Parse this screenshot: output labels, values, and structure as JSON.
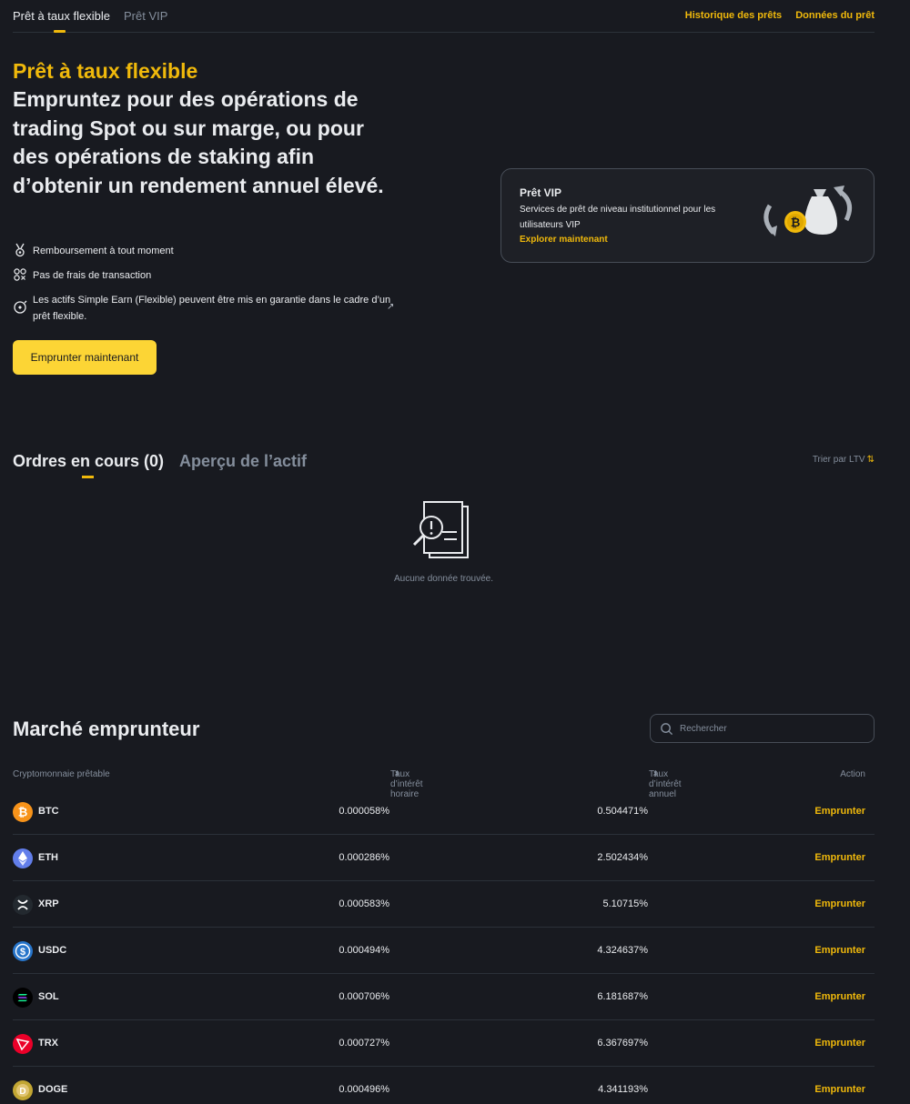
{
  "topnav": {
    "tab_flexible": "Prêt à taux flexible",
    "tab_vip": "Prêt VIP",
    "link_history": "Historique des prêts",
    "link_data": "Données du prêt"
  },
  "hero": {
    "title": "Prêt à taux flexible",
    "subtitle": "Empruntez pour des opérations de trading Spot ou sur marge, ou pour des opérations de staking afin d’obtenir un rendement annuel élevé.",
    "features": [
      {
        "icon": "medal-icon",
        "text": "Remboursement à tout moment"
      },
      {
        "icon": "coins-icon",
        "text": "Pas de frais de transaction"
      },
      {
        "icon": "collateral-icon",
        "text": "Les actifs Simple Earn (Flexible) peuvent être mis en garantie dans le cadre d’un prêt flexible."
      }
    ],
    "external_glyph": "↗",
    "borrow_button": "Emprunter maintenant"
  },
  "vip_card": {
    "title": "Prêt VIP",
    "description": "Services de prêt de niveau institutionnel pour les utilisateurs VIP",
    "link": "Explorer maintenant"
  },
  "orders": {
    "tab_open": "Ordres en cours (0)",
    "tab_assets": "Aperçu de l’actif",
    "sort_label": "Trier par LTV",
    "sort_icon": "⇅",
    "empty_text": "Aucune donnée trouvée."
  },
  "market": {
    "title": "Marché emprunteur",
    "search_placeholder": "Rechercher",
    "columns": {
      "coin": "Cryptomonnaie prêtable",
      "hourly": "Taux d’intérêt horaire",
      "annual": "Taux d’intérêt annuel",
      "action": "Action"
    },
    "sort_glyph": "⬍",
    "rows": [
      {
        "symbol": "BTC",
        "hourly": "0.000058%",
        "annual": "0.504471%",
        "action": "Emprunter",
        "icon": "btc-icon",
        "color": "#f7931a"
      },
      {
        "symbol": "ETH",
        "hourly": "0.000286%",
        "annual": "2.502434%",
        "action": "Emprunter",
        "icon": "eth-icon",
        "color": "#627eea"
      },
      {
        "symbol": "XRP",
        "hourly": "0.000583%",
        "annual": "5.10715%",
        "action": "Emprunter",
        "icon": "xrp-icon",
        "color": "#23292f"
      },
      {
        "symbol": "USDC",
        "hourly": "0.000494%",
        "annual": "4.324637%",
        "action": "Emprunter",
        "icon": "usdc-icon",
        "color": "#2775ca"
      },
      {
        "symbol": "SOL",
        "hourly": "0.000706%",
        "annual": "6.181687%",
        "action": "Emprunter",
        "icon": "sol-icon",
        "color": "#000000"
      },
      {
        "symbol": "TRX",
        "hourly": "0.000727%",
        "annual": "6.367697%",
        "action": "Emprunter",
        "icon": "trx-icon",
        "color": "#eb0029"
      },
      {
        "symbol": "DOGE",
        "hourly": "0.000496%",
        "annual": "4.341193%",
        "action": "Emprunter",
        "icon": "doge-icon",
        "color": "#c2a633"
      }
    ]
  },
  "colors": {
    "accent": "#f0b90b",
    "button": "#fcd535",
    "background": "#181a20"
  }
}
